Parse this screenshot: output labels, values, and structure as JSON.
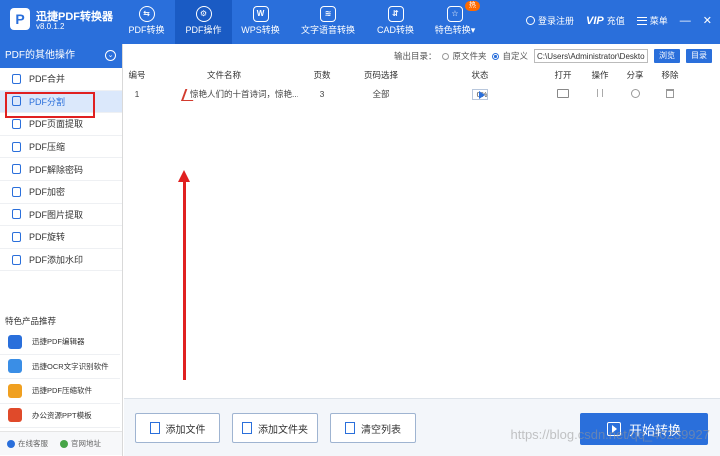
{
  "app": {
    "logo_letter": "P",
    "title": "迅捷PDF转换器",
    "version": "v8.0.1.2"
  },
  "nav": [
    {
      "label": "PDF转换",
      "icon": "convert-icon"
    },
    {
      "label": "PDF操作",
      "icon": "gear-icon",
      "active": true
    },
    {
      "label": "WPS转换",
      "icon": "wps-icon"
    },
    {
      "label": "文字语音转换",
      "icon": "audio-wave-icon"
    },
    {
      "label": "CAD转换",
      "icon": "cad-icon"
    },
    {
      "label": "特色转换",
      "icon": "star-icon",
      "badge": "热",
      "dropdown_glyph": "▾"
    }
  ],
  "topright": {
    "login": "登录注册",
    "vip": "VIP",
    "recharge": "充值",
    "menu": "菜单",
    "minimize": "—",
    "close": "✕"
  },
  "sidebar": {
    "header": "PDF的其他操作",
    "collapse_glyph": "⌄",
    "items": [
      {
        "label": "PDF合并",
        "icon": "merge-icon"
      },
      {
        "label": "PDF分割",
        "icon": "split-icon",
        "active": true
      },
      {
        "label": "PDF页面提取",
        "icon": "page-extract-icon"
      },
      {
        "label": "PDF压缩",
        "icon": "compress-icon"
      },
      {
        "label": "PDF解除密码",
        "icon": "unlock-icon"
      },
      {
        "label": "PDF加密",
        "icon": "lock-icon"
      },
      {
        "label": "PDF图片提取",
        "icon": "image-extract-icon"
      },
      {
        "label": "PDF旋转",
        "icon": "rotate-icon"
      },
      {
        "label": "PDF添加水印",
        "icon": "watermark-icon"
      }
    ],
    "recommend_title": "特色产品推荐",
    "recommend": [
      {
        "label": "迅捷PDF编辑器",
        "icon": "pdf-editor-icon",
        "color": "#2a6fdb"
      },
      {
        "label": "迅捷OCR文字识别软件",
        "icon": "ocr-icon",
        "color": "#3a8ee6"
      },
      {
        "label": "迅捷PDF压缩软件",
        "icon": "pdf-compress-icon",
        "color": "#f0a020"
      },
      {
        "label": "办公资源PPT模板",
        "icon": "ppt-template-icon",
        "color": "#e04a2a"
      }
    ],
    "footer": {
      "service": "在线客服",
      "website": "官网地址"
    }
  },
  "output": {
    "label": "输出目录：",
    "option_original": "原文件夹",
    "option_custom": "自定义",
    "path": "C:\\Users\\Administrator\\Desktop",
    "browse": "浏览",
    "dir": "目录"
  },
  "table": {
    "headers": {
      "no": "编号",
      "name": "文件名称",
      "pages": "页数",
      "range": "页码选择",
      "status": "状态",
      "open": "打开",
      "op": "操作",
      "share": "分享",
      "remove": "移除"
    },
    "rows": [
      {
        "no": "1",
        "name": "惊艳人们的十首诗词，惊艳...",
        "pages": "3",
        "range": "全部",
        "progress_text": "0%",
        "progress": 0
      }
    ]
  },
  "bottom": {
    "add_file": "添加文件",
    "add_folder": "添加文件夹",
    "clear_list": "清空列表",
    "start": "开始转换"
  },
  "watermark": "https://blog.csdn.net/qq_40239927"
}
